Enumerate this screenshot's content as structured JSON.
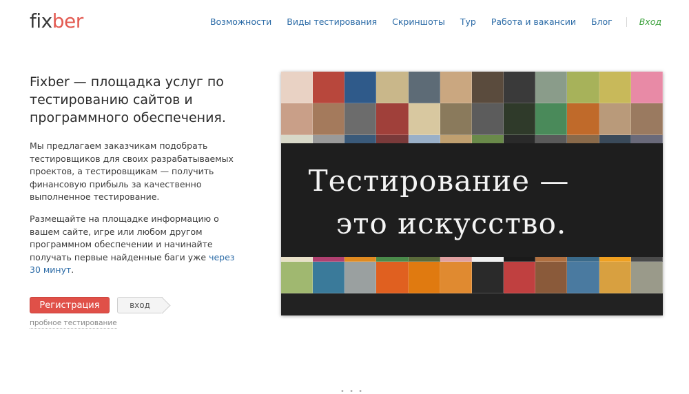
{
  "logo": {
    "part1": "fix",
    "part2": "ber"
  },
  "nav": {
    "items": [
      "Возможности",
      "Виды тестирования",
      "Скриншоты",
      "Тур",
      "Работа и вакансии",
      "Блог"
    ],
    "login": "Вход"
  },
  "hero_text": {
    "headline": "Fixber — площадка услуг по тестированию сайтов и программного обеспечения.",
    "para1": "Мы предлагаем заказчикам подобрать тестировщиков для своих разрабатываемых проектов, а тестировщикам — получить финансовую прибыль за качественно выполненное тестирование.",
    "para2": "Размещайте на площадке информацию о вашем сайте, игре или любом другом программном обеспечении и начинайте получать первые найденные баги уже",
    "para2_link": "через 30 минут",
    "para2_end": "."
  },
  "buttons": {
    "register": "Регистрация",
    "login": "вход",
    "trial": "пробное тестирование"
  },
  "banner": {
    "line1": "Тестирование —",
    "line2": "это искусство."
  },
  "footer": {
    "dots": "• • •"
  },
  "colors": {
    "brand_red": "#e35b52",
    "link_blue": "#2a6aa6",
    "login_green": "#3aa03a",
    "banner_bg": "#1e1e1e"
  },
  "tile_colors": [
    "#e9d2c4",
    "#b8473c",
    "#2f5a8a",
    "#c9b78a",
    "#5d6b76",
    "#caa780",
    "#5a4b3d",
    "#3a3a3a",
    "#8a9c8a",
    "#a7b25a",
    "#c8b95a",
    "#e88aa6",
    "#c99f88",
    "#a47a5c",
    "#6c6c6c",
    "#a0403a",
    "#d8c8a0",
    "#8a7a5c",
    "#5c5c5c",
    "#2f3a2a",
    "#4a8a5a",
    "#c06a2a",
    "#b99a7a",
    "#9a7a60",
    "#d8d8c8",
    "#9a9a9a",
    "#3a5a7a",
    "#7a3a3a",
    "#9ab0c8",
    "#c0a070",
    "#6a8a4a",
    "#2a2a2a",
    "#5a5a5a",
    "#8a6a4a",
    "#3a4a5a",
    "#6a6a7a",
    "#222222",
    "#222222",
    "#222222",
    "#222222",
    "#222222",
    "#222222",
    "#222222",
    "#222222",
    "#222222",
    "#222222",
    "#222222",
    "#222222",
    "#222222",
    "#222222",
    "#222222",
    "#222222",
    "#222222",
    "#222222",
    "#222222",
    "#222222",
    "#222222",
    "#222222",
    "#222222",
    "#222222",
    "#e8e0c8",
    "#b04070",
    "#e08a20",
    "#4a8a4a",
    "#5a6a3a",
    "#e0a0a0",
    "#f0f0f0",
    "#1a1a1a",
    "#b07040",
    "#3a6a8a",
    "#f0a020",
    "#4a4a4a",
    "#a0b870",
    "#3a7a9a",
    "#9aa0a0",
    "#e06020",
    "#e07a10",
    "#e08a30",
    "#2a2a2a",
    "#c04040",
    "#8a5a3a",
    "#4a7aa0",
    "#d8a040",
    "#9a9a8a"
  ]
}
